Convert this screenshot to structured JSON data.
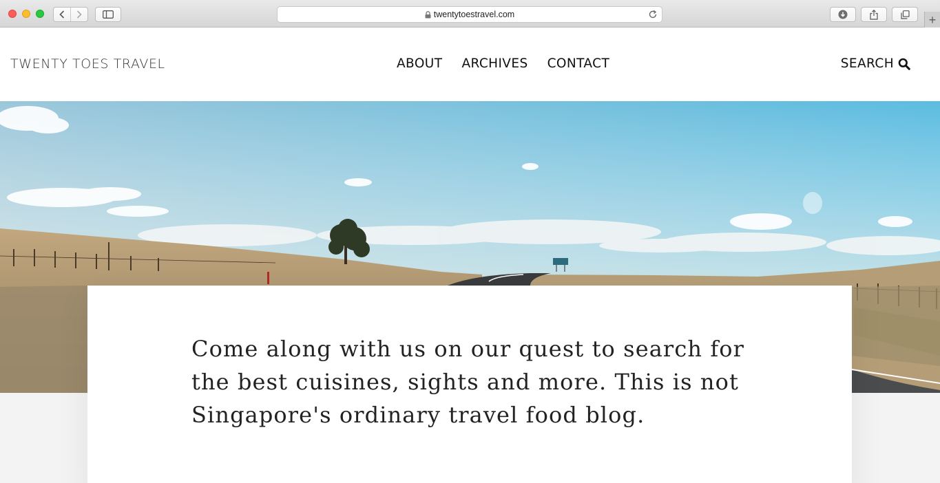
{
  "browser": {
    "url": "twentytoestravel.com",
    "icons": [
      "back-icon",
      "forward-icon",
      "sidebar-icon",
      "lock-icon",
      "reload-icon",
      "download-icon",
      "share-icon",
      "tabs-icon",
      "plus-icon"
    ]
  },
  "site": {
    "title": "TWENTY TOES TRAVEL",
    "nav": [
      "ABOUT",
      "ARCHIVES",
      "CONTACT"
    ],
    "search_label": "SEARCH"
  },
  "intro": {
    "text": "Come along with us on our quest to search for the best cuisines, sights and more. This is not Singapore's ordinary travel food blog."
  },
  "colors": {
    "accent_text": "#111111",
    "sky": "#93c5dc",
    "grass": "#b49a70"
  }
}
